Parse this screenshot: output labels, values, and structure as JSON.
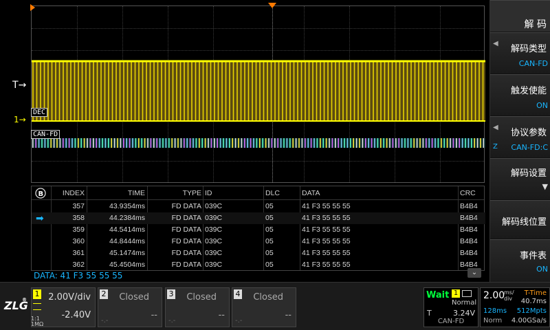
{
  "waveform": {
    "trigger_label": "T",
    "ch1_label": "1",
    "dec_label": "DEC",
    "can_label": "CAN-FD"
  },
  "menu": {
    "title": "解 码",
    "items": [
      {
        "title": "解码类型",
        "value": "CAN-FD"
      },
      {
        "title": "触发使能",
        "value": "ON"
      },
      {
        "title": "协议参数",
        "value": "CAN-FD:C",
        "side": "Z"
      },
      {
        "title": "解码设置",
        "value": "▼"
      },
      {
        "title": "解码线位置",
        "value": ""
      },
      {
        "title": "事件表",
        "value": "ON"
      }
    ]
  },
  "table": {
    "headers": [
      "INDEX",
      "TIME",
      "TYPE",
      "ID",
      "DLC",
      "DATA",
      "CRC"
    ],
    "rows": [
      {
        "index": "357",
        "time": "43.9354ms",
        "type": "FD DATA",
        "id": "039C",
        "dlc": "05",
        "data": "41 F3 55 55 55",
        "crc": "B4B4"
      },
      {
        "index": "358",
        "time": "44.2384ms",
        "type": "FD DATA",
        "id": "039C",
        "dlc": "05",
        "data": "41 F3 55 55 55",
        "crc": "B4B4"
      },
      {
        "index": "359",
        "time": "44.5414ms",
        "type": "FD DATA",
        "id": "039C",
        "dlc": "05",
        "data": "41 F3 55 55 55",
        "crc": "B4B4"
      },
      {
        "index": "360",
        "time": "44.8444ms",
        "type": "FD DATA",
        "id": "039C",
        "dlc": "05",
        "data": "41 F3 55 55 55",
        "crc": "B4B4"
      },
      {
        "index": "361",
        "time": "45.1474ms",
        "type": "FD DATA",
        "id": "039C",
        "dlc": "05",
        "data": "41 F3 55 55 55",
        "crc": "B4B4"
      },
      {
        "index": "362",
        "time": "45.4504ms",
        "type": "FD DATA",
        "id": "039C",
        "dlc": "05",
        "data": "41 F3 55 55 55",
        "crc": "B4B4"
      }
    ],
    "selected_index": "358"
  },
  "data_line": "DATA: 41 F3 55 55 55",
  "channels": [
    {
      "num": "1",
      "scale": "2.00V/div",
      "offset": "-2.40V",
      "coupling": "1:1",
      "impedance": "1MΩ"
    },
    {
      "num": "2",
      "scale": "Closed",
      "offset": "--",
      "sub": "-.-"
    },
    {
      "num": "3",
      "scale": "Closed",
      "offset": "--",
      "sub": "-.-"
    },
    {
      "num": "4",
      "scale": "Closed",
      "offset": "--",
      "sub": "-.-"
    }
  ],
  "trigger": {
    "status": "Wait",
    "source": "1",
    "mode": "Normal",
    "type_label": "T",
    "level": "3.24V",
    "protocol": "CAN-FD"
  },
  "timebase": {
    "value": "2.00",
    "unit_top": "ms/",
    "unit_bottom": "div",
    "t_label": "T-Time",
    "t_time": "40.7ms",
    "mem_a": "128ms",
    "mem_b": "512Mpts",
    "acq_mode": "Norm",
    "sample_rate": "4.00GSa/s"
  },
  "brand": "ZLG",
  "colors": {
    "ch1": "#ffff00",
    "accent": "#19b6ff",
    "trigger_marker": "#ff7a00",
    "wait": "#00ff3c"
  }
}
